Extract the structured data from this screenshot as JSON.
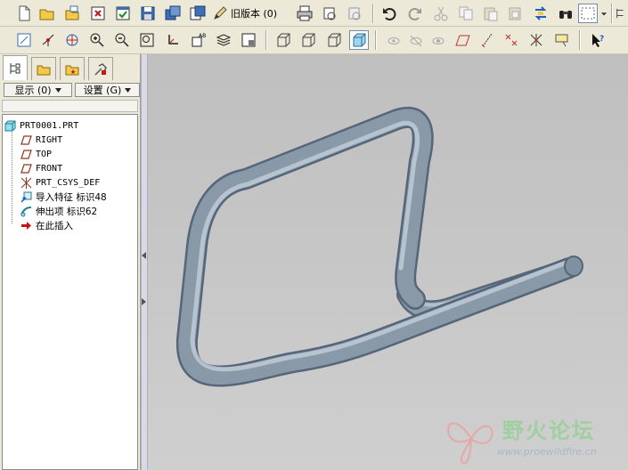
{
  "toolbar": {
    "old_version_label": "旧版本 (0)"
  },
  "panel": {
    "show_dropdown": "显示 (0)",
    "settings_dropdown": "设置 (G)"
  },
  "tree": {
    "items": [
      {
        "label": "PRT0001.PRT",
        "icon": "part-icon"
      },
      {
        "label": "RIGHT",
        "icon": "datum-plane-icon"
      },
      {
        "label": "TOP",
        "icon": "datum-plane-icon"
      },
      {
        "label": "FRONT",
        "icon": "datum-plane-icon"
      },
      {
        "label": "PRT_CSYS_DEF",
        "icon": "csys-icon"
      },
      {
        "label": "导入特征 标识48",
        "icon": "import-feature-icon"
      },
      {
        "label": "伸出项 标识62",
        "icon": "protrusion-icon"
      },
      {
        "label": "在此插入",
        "icon": "insert-here-arrow-icon"
      }
    ]
  },
  "watermark": {
    "text": "野火论坛",
    "url": "www.proewildfire.cn"
  },
  "colors": {
    "toolbar_bg": "#ece9d8",
    "viewport_bg": "#c4c4c4",
    "model": "#8a9aa8",
    "insert_arrow": "#cc1010"
  }
}
